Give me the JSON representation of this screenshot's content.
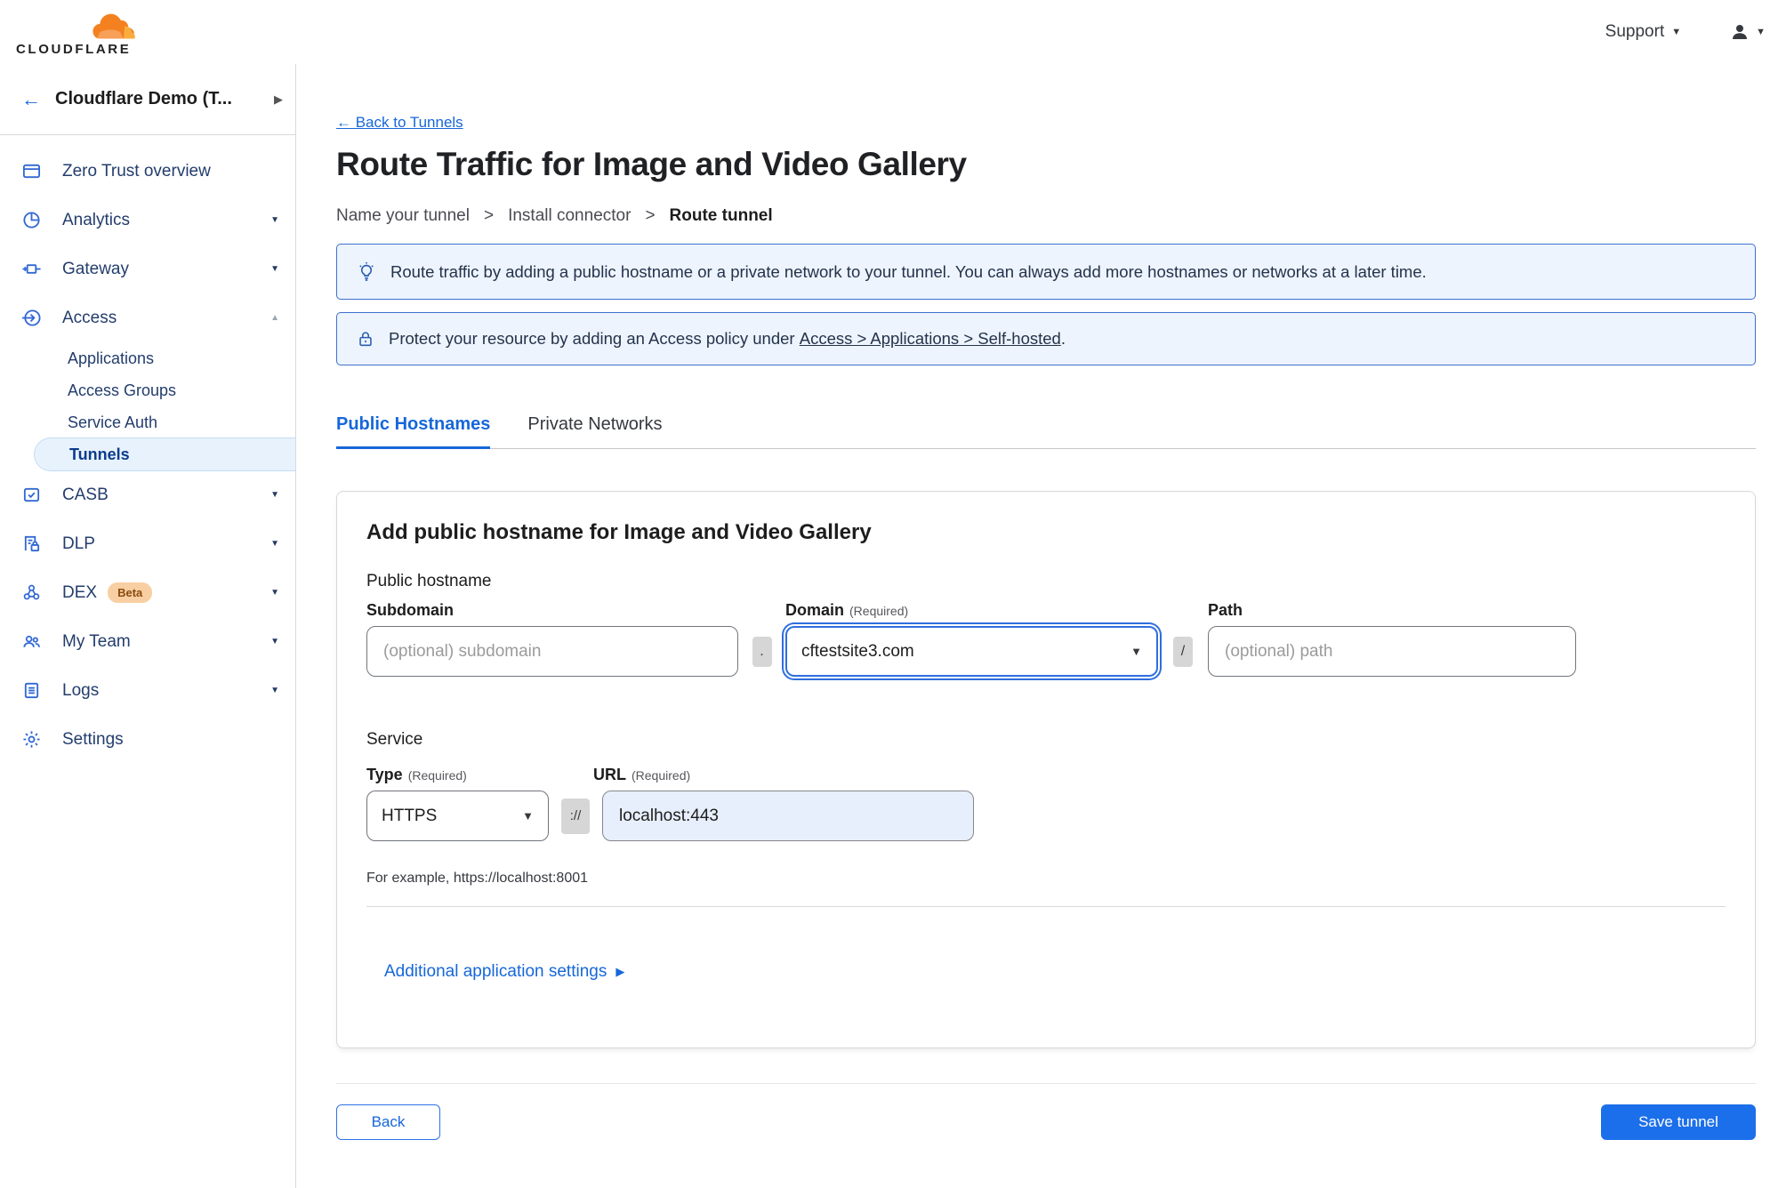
{
  "topbar": {
    "support_label": "Support"
  },
  "logo": {
    "text": "CLOUDFLARE"
  },
  "icons": {
    "chevron_down": "▼",
    "chevron_up": "▲",
    "chevron_right_small": "▶",
    "side_expand": "▶",
    "back_arrow": "←"
  },
  "sidebar": {
    "account_label": "Cloudflare Demo (T...",
    "items": [
      {
        "label": "Zero Trust overview"
      },
      {
        "label": "Analytics"
      },
      {
        "label": "Gateway"
      },
      {
        "label": "Access"
      },
      {
        "label": "CASB"
      },
      {
        "label": "DLP"
      },
      {
        "label": "DEX"
      },
      {
        "label": "My Team"
      },
      {
        "label": "Logs"
      },
      {
        "label": "Settings"
      }
    ],
    "access_subitems": [
      {
        "label": "Applications"
      },
      {
        "label": "Access Groups"
      },
      {
        "label": "Service Auth"
      },
      {
        "label": "Tunnels",
        "active": true
      }
    ],
    "beta_label": "Beta"
  },
  "header": {
    "back_link": "← Back to Tunnels",
    "title": "Route Traffic for Image and Video Gallery",
    "breadcrumb": [
      "Name your tunnel",
      "Install connector",
      "Route tunnel"
    ],
    "breadcrumb_separator": ">"
  },
  "banners": [
    {
      "icon": "lightbulb",
      "text": "Route traffic by adding a public hostname or a private network to your tunnel. You can always add more hostnames or networks at a later time."
    },
    {
      "icon": "lock",
      "text_prefix": "Protect your resource by adding an Access policy under",
      "link_text": "Access > Applications > Self-hosted",
      "text_suffix": "."
    }
  ],
  "tabs": [
    {
      "label": "Public Hostnames",
      "active": true
    },
    {
      "label": "Private Networks",
      "active": false
    }
  ],
  "form": {
    "heading": "Add public hostname for Image and Video Gallery",
    "public_hostname_label": "Public hostname",
    "subdomain": {
      "label": "Subdomain",
      "placeholder": "(optional) subdomain",
      "value": ""
    },
    "domain": {
      "label": "Domain",
      "required": "(Required)",
      "value": "cftestsite3.com"
    },
    "path": {
      "label": "Path",
      "placeholder": "(optional) path",
      "value": ""
    },
    "separators": {
      "dot": ".",
      "slash": "/",
      "scheme": "://"
    },
    "service_label": "Service",
    "type": {
      "label": "Type",
      "required": "(Required)",
      "value": "HTTPS"
    },
    "url": {
      "label": "URL",
      "required": "(Required)",
      "value": "localhost:443"
    },
    "example": "For example, https://localhost:8001",
    "additional_settings_label": "Additional application settings"
  },
  "footer": {
    "back_label": "Back",
    "save_label": "Save tunnel"
  },
  "colors": {
    "link_blue": "#1667d9",
    "button_blue": "#1c6fea",
    "banner_bg": "#edf4fd",
    "banner_border": "#3e70cf",
    "active_item_bg": "#e8f2fc",
    "url_field_bg": "#e7effc",
    "beta_badge_bg": "#f8cfa3",
    "sidebar_icon_blue": "#3168d4"
  }
}
